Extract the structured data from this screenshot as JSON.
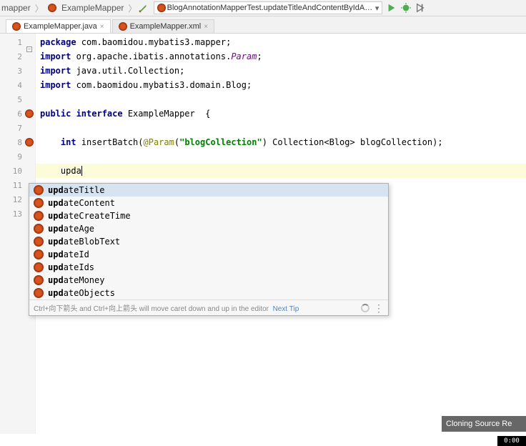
{
  "toolbar": {
    "breadcrumb_mapper": "mapper",
    "breadcrumb_file": "ExampleMapper",
    "run_config": "BlogAnnotationMapperTest.updateTitleAndContentByIdAndTitle"
  },
  "tabs": [
    {
      "label": "ExampleMapper.java",
      "active": true
    },
    {
      "label": "ExampleMapper.xml",
      "active": false
    }
  ],
  "code": {
    "line1_kw": "package ",
    "line1_rest": "com.baomidou.mybatis3.mapper;",
    "line2_kw": "import ",
    "line2_pkg": "org.apache.ibatis.annotations.",
    "line2_cls": "Param",
    "line2_end": ";",
    "line3_kw": "import ",
    "line3_rest": "java.util.Collection;",
    "line4_kw": "import ",
    "line4_rest": "com.baomidou.mybatis3.domain.Blog;",
    "line6_public": "public ",
    "line6_interface": "interface ",
    "line6_name": "ExampleMapper  {",
    "line8_type": "    int ",
    "line8_method": "insertBatch(",
    "line8_ann": "@Param",
    "line8_paren": "(",
    "line8_str": "\"blogCollection\"",
    "line8_rest": ") Collection<Blog> blogCollection);",
    "line10_indent": "    ",
    "line10_text": "upda"
  },
  "line_numbers": [
    "1",
    "2",
    "3",
    "4",
    "5",
    "6",
    "7",
    "8",
    "9",
    "10",
    "11",
    "12",
    "13"
  ],
  "popup": {
    "tip_text": "Ctrl+向下箭头 and Ctrl+向上箭头 will move caret down and up in the editor",
    "next_tip": "Next Tip",
    "items": [
      {
        "match": "upd",
        "rest": "ateTitle"
      },
      {
        "match": "upd",
        "rest": "ateContent"
      },
      {
        "match": "upd",
        "rest": "ateCreateTime"
      },
      {
        "match": "upd",
        "rest": "ateAge"
      },
      {
        "match": "upd",
        "rest": "ateBlobText"
      },
      {
        "match": "upd",
        "rest": "ateId"
      },
      {
        "match": "upd",
        "rest": "ateIds"
      },
      {
        "match": "upd",
        "rest": "ateMoney"
      },
      {
        "match": "upd",
        "rest": "ateObjects"
      }
    ]
  },
  "cloning": "Cloning Source Re",
  "timer": "0:00"
}
